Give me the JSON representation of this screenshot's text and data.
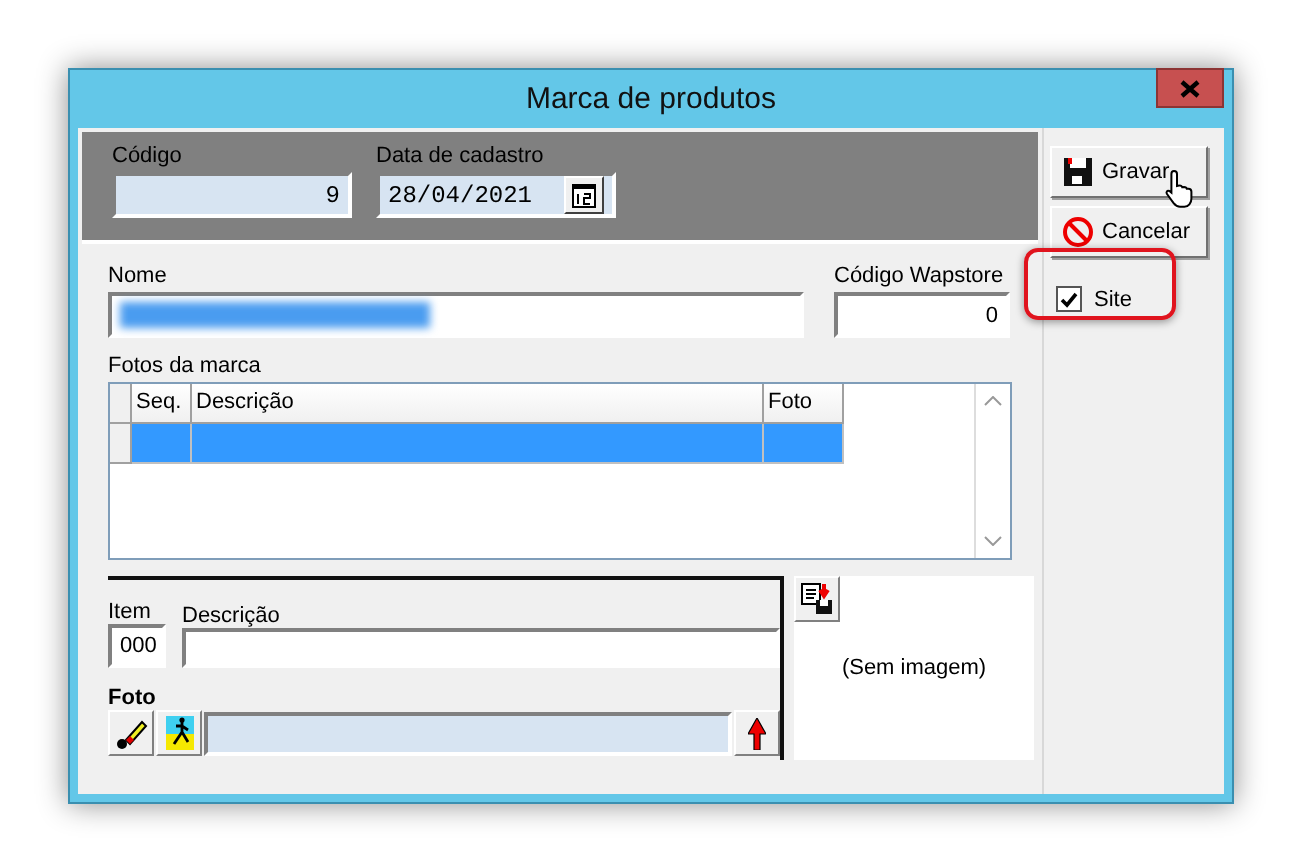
{
  "window": {
    "title": "Marca de produtos"
  },
  "header": {
    "codigo": {
      "label": "Código",
      "value": "9"
    },
    "data_cadastro": {
      "label": "Data de cadastro",
      "value": "28/04/2021"
    }
  },
  "nome": {
    "label": "Nome",
    "redacted": true
  },
  "codigo_wapstore": {
    "label": "Código Wapstore",
    "value": "0"
  },
  "fotos": {
    "label": "Fotos da marca",
    "columns": [
      "Seq.",
      "Descrição",
      "Foto"
    ],
    "rows": [
      {
        "selected": true
      }
    ]
  },
  "item": {
    "label": "Item",
    "value": "000"
  },
  "descricao": {
    "label": "Descrição"
  },
  "foto": {
    "label": "Foto",
    "preview": "(Sem imagem)"
  },
  "buttons": [
    {
      "label": "Gravar",
      "kind": "save",
      "hovered": true
    },
    {
      "label": "Cancelar",
      "kind": "cancel",
      "hovered": false
    }
  ],
  "site": {
    "label": "Site",
    "checked": true,
    "highlighted": true
  }
}
